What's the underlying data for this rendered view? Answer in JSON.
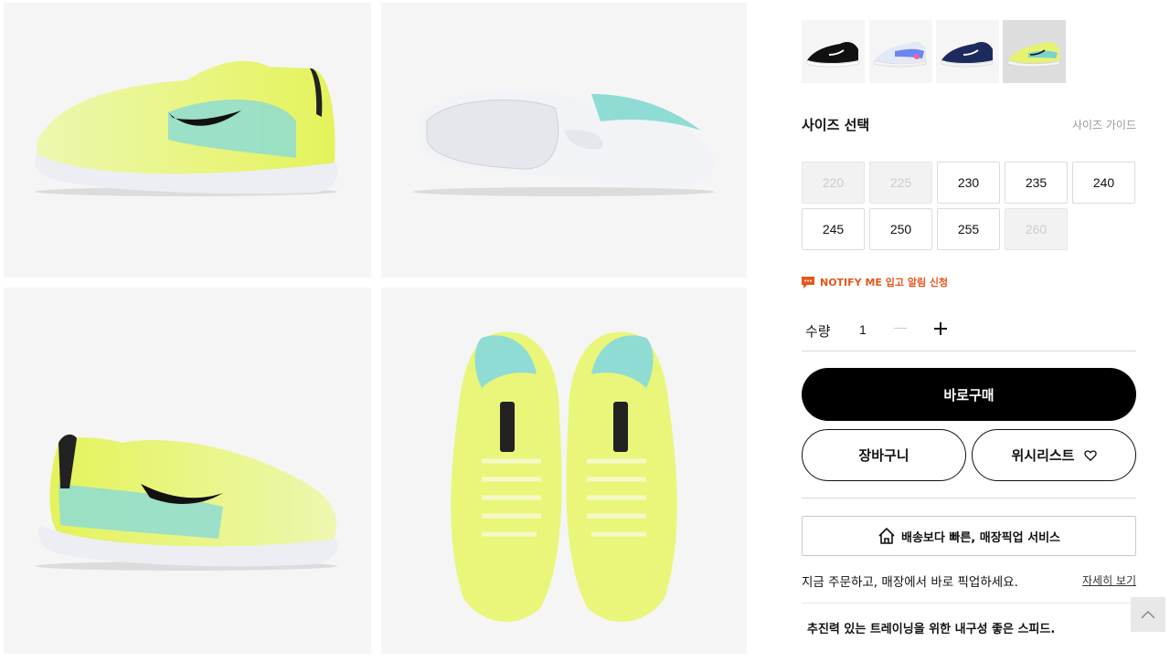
{
  "gallery": {
    "images": [
      {
        "name": "side view"
      },
      {
        "name": "outsole view"
      },
      {
        "name": "medial side view"
      },
      {
        "name": "top view pair"
      }
    ],
    "colors": {
      "upper": "#e9f56b",
      "accent": "#7fd6d2",
      "sole": "#efeff4",
      "swoosh": "#1a1a1a"
    }
  },
  "swatches": [
    {
      "color": "#111111",
      "accent": "#ffffff"
    },
    {
      "color": "#e8ecf7",
      "accent": "#5b7cf5"
    },
    {
      "color": "#1d2a5e",
      "accent": "#ffffff"
    },
    {
      "color": "#e7f270",
      "accent": "#79d3cf",
      "selected": true
    }
  ],
  "size": {
    "title": "사이즈 선택",
    "guide": "사이즈 가이드",
    "options": [
      {
        "label": "220",
        "available": false
      },
      {
        "label": "225",
        "available": false
      },
      {
        "label": "230",
        "available": true
      },
      {
        "label": "235",
        "available": true
      },
      {
        "label": "240",
        "available": true
      },
      {
        "label": "245",
        "available": true
      },
      {
        "label": "250",
        "available": true
      },
      {
        "label": "255",
        "available": true
      },
      {
        "label": "260",
        "available": false
      }
    ]
  },
  "notify": {
    "label": "NOTIFY ME 입고 알림 신청",
    "color": "#e4571b"
  },
  "quantity": {
    "label": "수량",
    "value": "1"
  },
  "buttons": {
    "buy": "바로구매",
    "cart": "장바구니",
    "wishlist": "위시리스트"
  },
  "pickup": {
    "box_label": "배송보다 빠른, 매장픽업 서비스",
    "description": "지금 주문하고, 매장에서 바로 픽업하세요.",
    "more": "자세히 보기"
  },
  "product": {
    "tagline": "추진력 있는 트레이닝을 위한 내구성 좋은 스피드."
  }
}
